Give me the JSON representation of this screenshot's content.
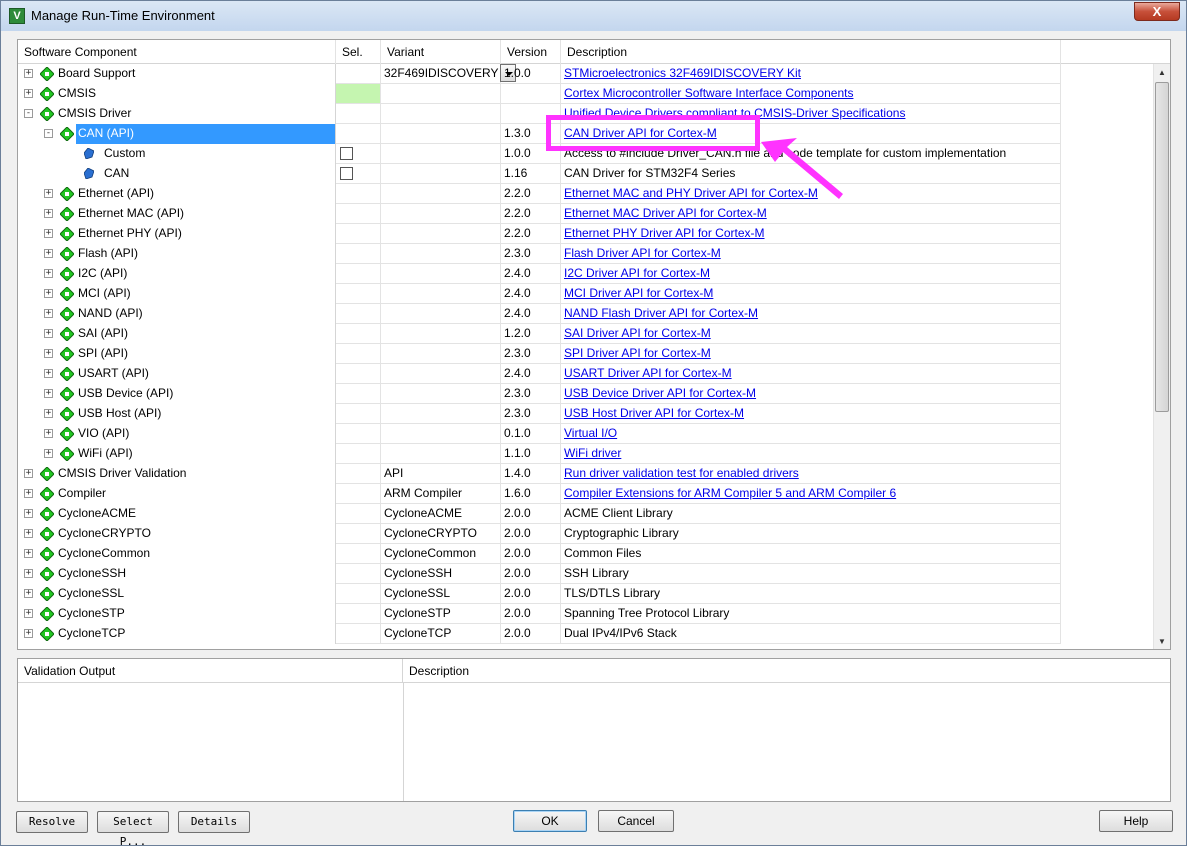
{
  "window": {
    "title": "Manage Run-Time Environment",
    "icon_letter": "V",
    "close_glyph": "X"
  },
  "columns": {
    "component": "Software Component",
    "sel": "Sel.",
    "variant": "Variant",
    "version": "Version",
    "description": "Description"
  },
  "rows": [
    {
      "name": "Board Support",
      "level": 0,
      "expander": "+",
      "icon": "diamond",
      "variant": "32F469IDISCOVERY",
      "dropdown": true,
      "version": "1.0.0",
      "desc": "STMicroelectronics 32F469IDISCOVERY Kit",
      "link": true
    },
    {
      "name": "CMSIS",
      "level": 0,
      "expander": "+",
      "icon": "diamond",
      "sel": "green",
      "variant": "",
      "version": "",
      "desc": "Cortex Microcontroller Software Interface Components",
      "link": true
    },
    {
      "name": "CMSIS Driver",
      "level": 0,
      "expander": "-",
      "icon": "diamond",
      "variant": "",
      "version": "",
      "desc": "Unified Device Drivers compliant to CMSIS-Driver Specifications",
      "link": true
    },
    {
      "name": "CAN (API)",
      "level": 1,
      "expander": "-",
      "icon": "diamond",
      "selected": true,
      "variant": "",
      "version": "1.3.0",
      "desc": "CAN Driver API for Cortex-M",
      "link": true
    },
    {
      "name": "Custom",
      "level": 2,
      "expander": "",
      "icon": "leaf",
      "sel": "checkbox",
      "variant": "",
      "version": "1.0.0",
      "desc": "Access to #include Driver_CAN.h file and code template for custom implementation",
      "link": false
    },
    {
      "name": "CAN",
      "level": 2,
      "expander": "",
      "icon": "leaf",
      "sel": "checkbox",
      "variant": "",
      "version": "1.16",
      "desc": "CAN Driver for STM32F4 Series",
      "link": false
    },
    {
      "name": "Ethernet (API)",
      "level": 1,
      "expander": "+",
      "icon": "diamond",
      "variant": "",
      "version": "2.2.0",
      "desc": "Ethernet MAC and PHY Driver API for Cortex-M",
      "link": true
    },
    {
      "name": "Ethernet MAC (API)",
      "level": 1,
      "expander": "+",
      "icon": "diamond",
      "variant": "",
      "version": "2.2.0",
      "desc": "Ethernet MAC Driver API for Cortex-M",
      "link": true
    },
    {
      "name": "Ethernet PHY (API)",
      "level": 1,
      "expander": "+",
      "icon": "diamond",
      "variant": "",
      "version": "2.2.0",
      "desc": "Ethernet PHY Driver API for Cortex-M",
      "link": true
    },
    {
      "name": "Flash (API)",
      "level": 1,
      "expander": "+",
      "icon": "diamond",
      "variant": "",
      "version": "2.3.0",
      "desc": "Flash Driver API for Cortex-M",
      "link": true
    },
    {
      "name": "I2C (API)",
      "level": 1,
      "expander": "+",
      "icon": "diamond",
      "variant": "",
      "version": "2.4.0",
      "desc": "I2C Driver API for Cortex-M",
      "link": true
    },
    {
      "name": "MCI (API)",
      "level": 1,
      "expander": "+",
      "icon": "diamond",
      "variant": "",
      "version": "2.4.0",
      "desc": "MCI Driver API for Cortex-M",
      "link": true
    },
    {
      "name": "NAND (API)",
      "level": 1,
      "expander": "+",
      "icon": "diamond",
      "variant": "",
      "version": "2.4.0",
      "desc": "NAND Flash Driver API for Cortex-M",
      "link": true
    },
    {
      "name": "SAI (API)",
      "level": 1,
      "expander": "+",
      "icon": "diamond",
      "variant": "",
      "version": "1.2.0",
      "desc": "SAI Driver API for Cortex-M",
      "link": true
    },
    {
      "name": "SPI (API)",
      "level": 1,
      "expander": "+",
      "icon": "diamond",
      "variant": "",
      "version": "2.3.0",
      "desc": "SPI Driver API for Cortex-M",
      "link": true
    },
    {
      "name": "USART (API)",
      "level": 1,
      "expander": "+",
      "icon": "diamond",
      "variant": "",
      "version": "2.4.0",
      "desc": "USART Driver API for Cortex-M",
      "link": true
    },
    {
      "name": "USB Device (API)",
      "level": 1,
      "expander": "+",
      "icon": "diamond",
      "variant": "",
      "version": "2.3.0",
      "desc": "USB Device Driver API for Cortex-M",
      "link": true
    },
    {
      "name": "USB Host (API)",
      "level": 1,
      "expander": "+",
      "icon": "diamond",
      "variant": "",
      "version": "2.3.0",
      "desc": "USB Host Driver API for Cortex-M",
      "link": true
    },
    {
      "name": "VIO (API)",
      "level": 1,
      "expander": "+",
      "icon": "diamond",
      "variant": "",
      "version": "0.1.0",
      "desc": "Virtual I/O",
      "link": true
    },
    {
      "name": "WiFi (API)",
      "level": 1,
      "expander": "+",
      "icon": "diamond",
      "variant": "",
      "version": "1.1.0",
      "desc": "WiFi driver",
      "link": true
    },
    {
      "name": "CMSIS Driver Validation",
      "level": 0,
      "expander": "+",
      "icon": "diamond",
      "variant": "API",
      "version": "1.4.0",
      "desc": "Run driver validation test for enabled drivers",
      "link": true
    },
    {
      "name": "Compiler",
      "level": 0,
      "expander": "+",
      "icon": "diamond",
      "variant": "ARM Compiler",
      "version": "1.6.0",
      "desc": "Compiler Extensions for ARM Compiler 5 and ARM Compiler 6",
      "link": true
    },
    {
      "name": "CycloneACME",
      "level": 0,
      "expander": "+",
      "icon": "diamond",
      "variant": "CycloneACME",
      "version": "2.0.0",
      "desc": "ACME Client Library",
      "link": false
    },
    {
      "name": "CycloneCRYPTO",
      "level": 0,
      "expander": "+",
      "icon": "diamond",
      "variant": "CycloneCRYPTO",
      "version": "2.0.0",
      "desc": "Cryptographic Library",
      "link": false
    },
    {
      "name": "CycloneCommon",
      "level": 0,
      "expander": "+",
      "icon": "diamond",
      "variant": "CycloneCommon",
      "version": "2.0.0",
      "desc": "Common Files",
      "link": false
    },
    {
      "name": "CycloneSSH",
      "level": 0,
      "expander": "+",
      "icon": "diamond",
      "variant": "CycloneSSH",
      "version": "2.0.0",
      "desc": "SSH Library",
      "link": false
    },
    {
      "name": "CycloneSSL",
      "level": 0,
      "expander": "+",
      "icon": "diamond",
      "variant": "CycloneSSL",
      "version": "2.0.0",
      "desc": "TLS/DTLS Library",
      "link": false
    },
    {
      "name": "CycloneSTP",
      "level": 0,
      "expander": "+",
      "icon": "diamond",
      "variant": "CycloneSTP",
      "version": "2.0.0",
      "desc": "Spanning Tree Protocol Library",
      "link": false
    },
    {
      "name": "CycloneTCP",
      "level": 0,
      "expander": "+",
      "icon": "diamond",
      "variant": "CycloneTCP",
      "version": "2.0.0",
      "desc": "Dual IPv4/IPv6 Stack",
      "link": false
    }
  ],
  "validation": {
    "col1": "Validation Output",
    "col2": "Description"
  },
  "buttons": {
    "resolve": "Resolve",
    "select_packs": "Select P...",
    "details": "Details",
    "ok": "OK",
    "cancel": "Cancel",
    "help": "Help"
  },
  "scrollbar": {
    "up_glyph": "▲",
    "down_glyph": "▼"
  },
  "colors": {
    "annotation": "#ff33ff",
    "selection": "#3399ff",
    "sel_green": "#c5f5b0",
    "link": "#0000e8",
    "icon_green": "#22c622"
  }
}
